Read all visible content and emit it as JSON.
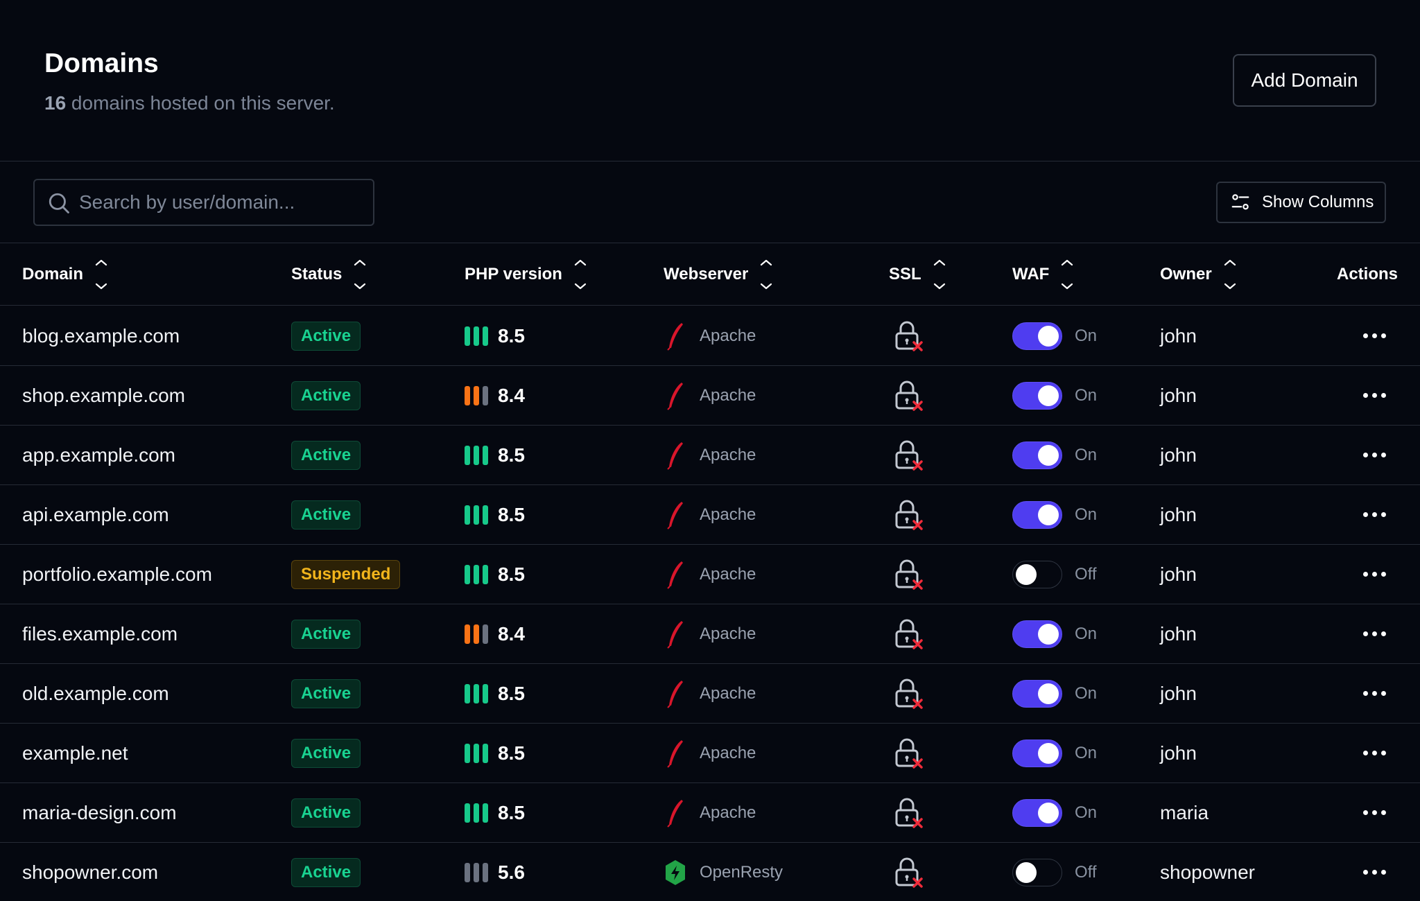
{
  "header": {
    "title": "Domains",
    "subtitle_count": "16",
    "subtitle_text": " domains hosted on this server.",
    "add_button": "Add Domain"
  },
  "toolbar": {
    "search_placeholder": "Search by user/domain...",
    "show_columns": "Show Columns"
  },
  "table": {
    "columns": [
      {
        "label": "Domain",
        "sortable": true
      },
      {
        "label": "Status",
        "sortable": true
      },
      {
        "label": "PHP version",
        "sortable": true
      },
      {
        "label": "Webserver",
        "sortable": true
      },
      {
        "label": "SSL",
        "sortable": true
      },
      {
        "label": "WAF",
        "sortable": true
      },
      {
        "label": "Owner",
        "sortable": true
      },
      {
        "label": "Actions",
        "sortable": false
      }
    ],
    "rows": [
      {
        "domain": "blog.example.com",
        "status": "Active",
        "status_kind": "active",
        "php": "8.5",
        "php_color": "#17c98a",
        "php_level": 3,
        "webserver": "Apache",
        "ws_icon": "apache-feather-icon",
        "ssl_icon": "lock-x-icon",
        "waf_on": true,
        "waf": "On",
        "owner": "john"
      },
      {
        "domain": "shop.example.com",
        "status": "Active",
        "status_kind": "active",
        "php": "8.4",
        "php_color": "#f97316",
        "php_level": 2,
        "webserver": "Apache",
        "ws_icon": "apache-feather-icon",
        "ssl_icon": "lock-x-icon",
        "waf_on": true,
        "waf": "On",
        "owner": "john"
      },
      {
        "domain": "app.example.com",
        "status": "Active",
        "status_kind": "active",
        "php": "8.5",
        "php_color": "#17c98a",
        "php_level": 3,
        "webserver": "Apache",
        "ws_icon": "apache-feather-icon",
        "ssl_icon": "lock-x-icon",
        "waf_on": true,
        "waf": "On",
        "owner": "john"
      },
      {
        "domain": "api.example.com",
        "status": "Active",
        "status_kind": "active",
        "php": "8.5",
        "php_color": "#17c98a",
        "php_level": 3,
        "webserver": "Apache",
        "ws_icon": "apache-feather-icon",
        "ssl_icon": "lock-x-icon",
        "waf_on": true,
        "waf": "On",
        "owner": "john"
      },
      {
        "domain": "portfolio.example.com",
        "status": "Suspended",
        "status_kind": "suspended",
        "php": "8.5",
        "php_color": "#17c98a",
        "php_level": 3,
        "webserver": "Apache",
        "ws_icon": "apache-feather-icon",
        "ssl_icon": "lock-x-icon",
        "waf_on": false,
        "waf": "Off",
        "owner": "john"
      },
      {
        "domain": "files.example.com",
        "status": "Active",
        "status_kind": "active",
        "php": "8.4",
        "php_color": "#f97316",
        "php_level": 2,
        "webserver": "Apache",
        "ws_icon": "apache-feather-icon",
        "ssl_icon": "lock-x-icon",
        "waf_on": true,
        "waf": "On",
        "owner": "john"
      },
      {
        "domain": "old.example.com",
        "status": "Active",
        "status_kind": "active",
        "php": "8.5",
        "php_color": "#17c98a",
        "php_level": 3,
        "webserver": "Apache",
        "ws_icon": "apache-feather-icon",
        "ssl_icon": "lock-x-icon",
        "waf_on": true,
        "waf": "On",
        "owner": "john"
      },
      {
        "domain": "example.net",
        "status": "Active",
        "status_kind": "active",
        "php": "8.5",
        "php_color": "#17c98a",
        "php_level": 3,
        "webserver": "Apache",
        "ws_icon": "apache-feather-icon",
        "ssl_icon": "lock-x-icon",
        "waf_on": true,
        "waf": "On",
        "owner": "john"
      },
      {
        "domain": "maria-design.com",
        "status": "Active",
        "status_kind": "active",
        "php": "8.5",
        "php_color": "#17c98a",
        "php_level": 3,
        "webserver": "Apache",
        "ws_icon": "apache-feather-icon",
        "ssl_icon": "lock-x-icon",
        "waf_on": true,
        "waf": "On",
        "owner": "maria"
      },
      {
        "domain": "shopowner.com",
        "status": "Active",
        "status_kind": "active",
        "php": "5.6",
        "php_color": "#6b7280",
        "php_level": 0,
        "webserver": "OpenResty",
        "ws_icon": "openresty-hexagon-icon",
        "ssl_icon": "lock-x-icon",
        "waf_on": false,
        "waf": "Off",
        "owner": "shopowner"
      }
    ]
  },
  "colors": {
    "background": "#050810",
    "accent_toggle": "#4f3df0",
    "active_green": "#19d391",
    "suspended_amber": "#f2b51c",
    "ssl_error_red": "#ef2b3a",
    "apache_red": "#d9162b",
    "openresty_green": "#22a447"
  }
}
